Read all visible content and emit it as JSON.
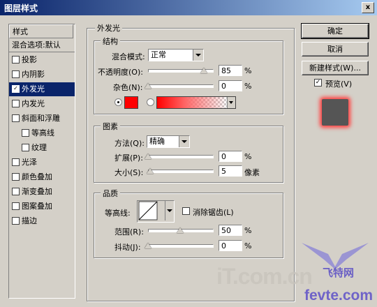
{
  "window": {
    "title": "图层样式",
    "close": "x"
  },
  "styles_list": {
    "header": "样式",
    "blend_default": "混合选项:默认",
    "items": [
      {
        "label": "投影",
        "checked": false,
        "indent": false
      },
      {
        "label": "内阴影",
        "checked": false,
        "indent": false
      },
      {
        "label": "外发光",
        "checked": true,
        "indent": false,
        "selected": true
      },
      {
        "label": "内发光",
        "checked": false,
        "indent": false
      },
      {
        "label": "斜面和浮雕",
        "checked": false,
        "indent": false
      },
      {
        "label": "等高线",
        "checked": false,
        "indent": true
      },
      {
        "label": "纹理",
        "checked": false,
        "indent": true
      },
      {
        "label": "光泽",
        "checked": false,
        "indent": false
      },
      {
        "label": "颜色叠加",
        "checked": false,
        "indent": false
      },
      {
        "label": "渐变叠加",
        "checked": false,
        "indent": false
      },
      {
        "label": "图案叠加",
        "checked": false,
        "indent": false
      },
      {
        "label": "描边",
        "checked": false,
        "indent": false
      }
    ]
  },
  "panel": {
    "title": "外发光",
    "structure": {
      "title": "结构",
      "blend_mode_label": "混合模式:",
      "blend_mode_value": "正常",
      "opacity_label": "不透明度(O):",
      "opacity_value": "85",
      "opacity_unit": "%",
      "noise_label": "杂色(N):",
      "noise_value": "0",
      "noise_unit": "%",
      "glow_color": "#ff0000",
      "gradient_mode_selected": false
    },
    "elements": {
      "title": "图素",
      "technique_label": "方法(Q):",
      "technique_value": "精确",
      "spread_label": "扩展(P):",
      "spread_value": "0",
      "spread_unit": "%",
      "size_label": "大小(S):",
      "size_value": "5",
      "size_unit": "像素"
    },
    "quality": {
      "title": "品质",
      "contour_label": "等高线:",
      "antialias_label": "消除锯齿(L)",
      "antialias_checked": false,
      "range_label": "范围(R):",
      "range_value": "50",
      "range_unit": "%",
      "jitter_label": "抖动(J):",
      "jitter_value": "0",
      "jitter_unit": "%"
    }
  },
  "buttons": {
    "ok": "确定",
    "cancel": "取消",
    "new_style": "新建样式(W)...",
    "preview_label": "预览(V)",
    "preview_checked": true
  },
  "watermark": {
    "left": "iT.com.cn",
    "right_top": "飞特网",
    "right_bottom": "fevte.com"
  },
  "colors": {
    "titlebar": "#0a246a",
    "selection": "#0a246a",
    "dialog_bg": "#d4d0c8",
    "glow": "#ff0000",
    "watermark": "#7b6fc7"
  }
}
